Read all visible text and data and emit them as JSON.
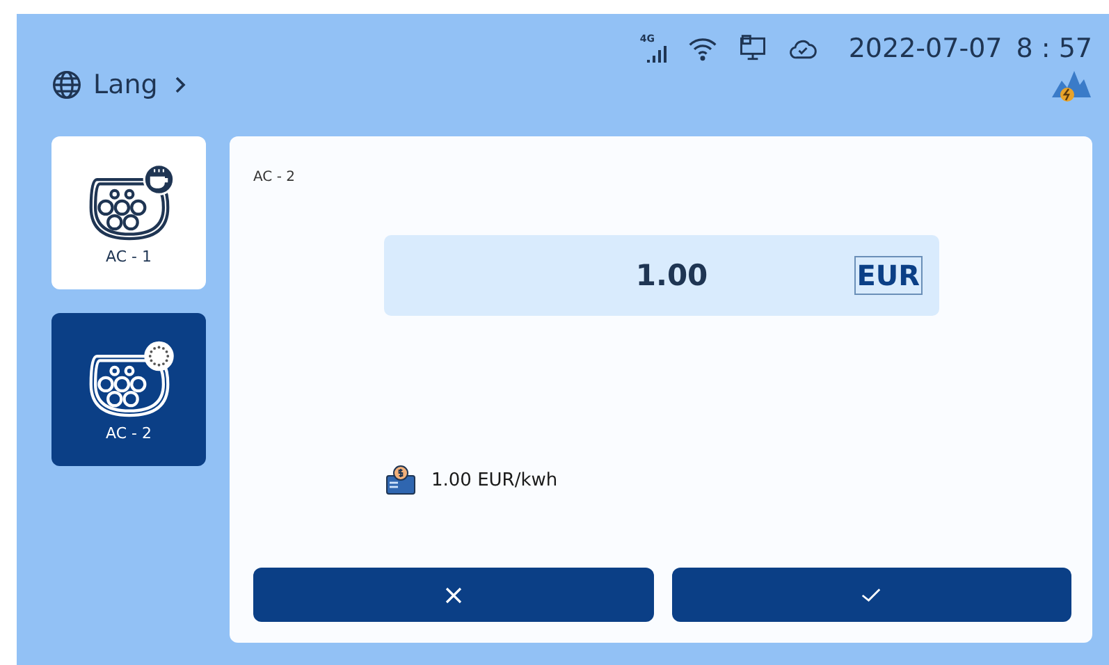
{
  "header": {
    "language": "Lang",
    "network": "4G",
    "date": "2022-07-07",
    "time": "8 : 57"
  },
  "connectors": [
    {
      "label": "AC - 1",
      "selected": false,
      "kind": "idle"
    },
    {
      "label": "AC - 2",
      "selected": true,
      "kind": "busy"
    }
  ],
  "panel": {
    "title": "AC - 2",
    "amount": "1.00",
    "currency": "EUR",
    "rate": "1.00 EUR/kwh"
  },
  "buttons": [
    {
      "kind": "cancel"
    },
    {
      "kind": "confirm"
    }
  ]
}
